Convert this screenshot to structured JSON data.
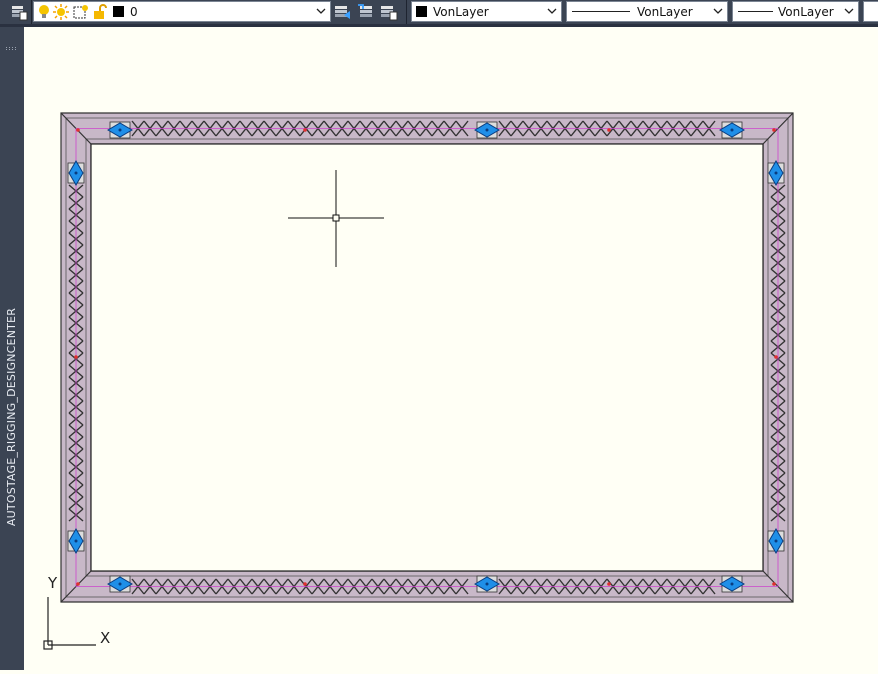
{
  "toolbar": {
    "layer": {
      "name": "0",
      "color": "#000000"
    },
    "color": {
      "label": "VonLayer",
      "swatch": "#000000"
    },
    "linetype": {
      "label": "VonLayer"
    },
    "lineweight": {
      "label": "VonLayer"
    }
  },
  "palette": {
    "title": "AUTOSTAGE_RIGGING_DESIGNCENTER"
  },
  "ucs": {
    "x_label": "X",
    "y_label": "Y"
  },
  "colors": {
    "background": "#fffff5",
    "truss_fill": "#c8b8c8",
    "clamp_blue": "#1f8fe8",
    "node_red": "#e03030",
    "guide_magenta": "#cc44cc"
  }
}
